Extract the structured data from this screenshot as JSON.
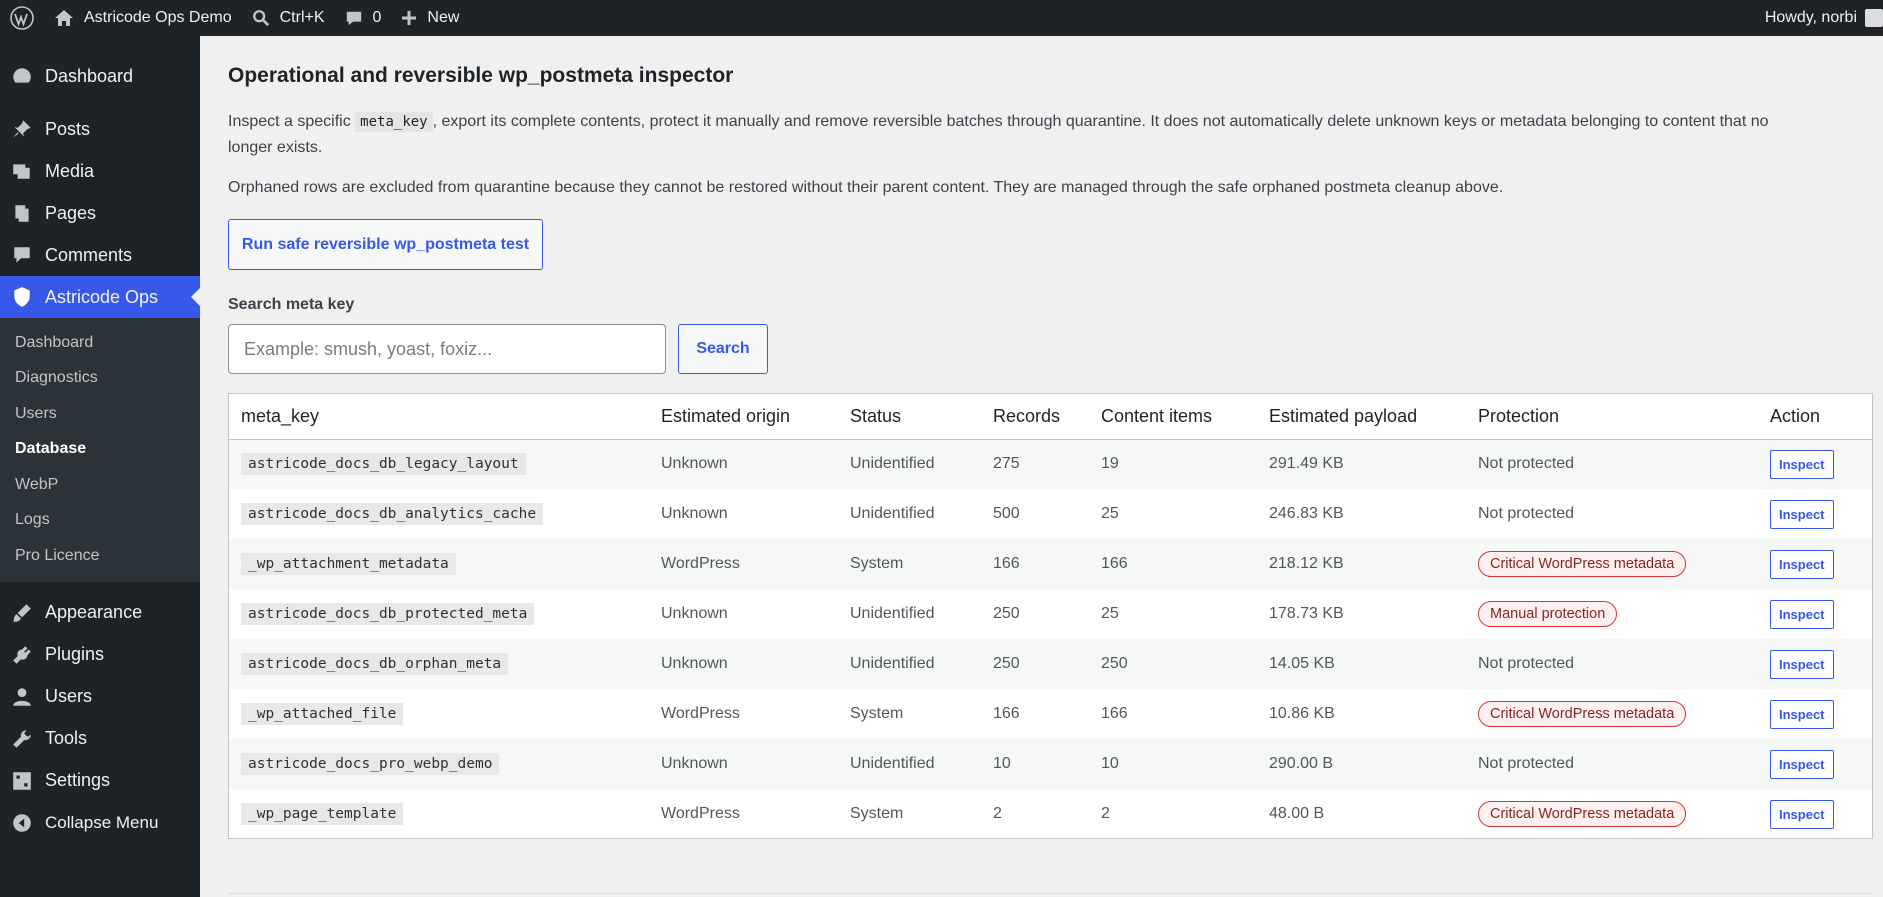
{
  "adminbar": {
    "site_name": "Astricode Ops Demo",
    "search_shortcut": "Ctrl+K",
    "comments_count": "0",
    "new_label": "New",
    "howdy": "Howdy, norbi"
  },
  "sidebar": {
    "items_top": [
      {
        "label": "Dashboard",
        "icon": "dashboard-icon"
      },
      {
        "label": "Posts",
        "icon": "pushpin-icon"
      },
      {
        "label": "Media",
        "icon": "media-icon"
      },
      {
        "label": "Pages",
        "icon": "pages-icon"
      },
      {
        "label": "Comments",
        "icon": "comment-icon"
      },
      {
        "label": "Astricode Ops",
        "icon": "shield-icon"
      }
    ],
    "submenu": [
      "Dashboard",
      "Diagnostics",
      "Users",
      "Database",
      "WebP",
      "Logs",
      "Pro Licence"
    ],
    "items_bottom": [
      {
        "label": "Appearance",
        "icon": "brush-icon"
      },
      {
        "label": "Plugins",
        "icon": "plug-icon"
      },
      {
        "label": "Users",
        "icon": "user-icon"
      },
      {
        "label": "Tools",
        "icon": "wrench-icon"
      },
      {
        "label": "Settings",
        "icon": "settings-icon"
      },
      {
        "label": "Collapse Menu",
        "icon": "collapse-icon"
      }
    ]
  },
  "main": {
    "title": "Operational and reversible wp_postmeta inspector",
    "desc1_before": "Inspect a specific ",
    "desc1_code": "meta_key",
    "desc1_after": ", export its complete contents, protect it manually and remove reversible batches through quarantine. It does not automatically delete unknown keys or metadata belonging to content that no longer exists.",
    "desc2": "Orphaned rows are excluded from quarantine because they cannot be restored without their parent content. They are managed through the safe orphaned postmeta cleanup above.",
    "run_button": "Run safe reversible wp_postmeta test",
    "search_label": "Search meta key",
    "search_placeholder": "Example: smush, yoast, foxiz...",
    "search_button": "Search"
  },
  "table": {
    "headers": [
      "meta_key",
      "Estimated origin",
      "Status",
      "Records",
      "Content items",
      "Estimated payload",
      "Protection",
      "Action"
    ],
    "rows": [
      {
        "key": "astricode_docs_db_legacy_layout",
        "origin": "Unknown",
        "status": "Unidentified",
        "records": "275",
        "items": "19",
        "payload": "291.49 KB",
        "protection": "Not protected",
        "badge": false,
        "action": "Inspect"
      },
      {
        "key": "astricode_docs_db_analytics_cache",
        "origin": "Unknown",
        "status": "Unidentified",
        "records": "500",
        "items": "25",
        "payload": "246.83 KB",
        "protection": "Not protected",
        "badge": false,
        "action": "Inspect"
      },
      {
        "key": "_wp_attachment_metadata",
        "origin": "WordPress",
        "status": "System",
        "records": "166",
        "items": "166",
        "payload": "218.12 KB",
        "protection": "Critical WordPress metadata",
        "badge": true,
        "action": "Inspect"
      },
      {
        "key": "astricode_docs_db_protected_meta",
        "origin": "Unknown",
        "status": "Unidentified",
        "records": "250",
        "items": "25",
        "payload": "178.73 KB",
        "protection": "Manual protection",
        "badge": true,
        "action": "Inspect"
      },
      {
        "key": "astricode_docs_db_orphan_meta",
        "origin": "Unknown",
        "status": "Unidentified",
        "records": "250",
        "items": "250",
        "payload": "14.05 KB",
        "protection": "Not protected",
        "badge": false,
        "action": "Inspect"
      },
      {
        "key": "_wp_attached_file",
        "origin": "WordPress",
        "status": "System",
        "records": "166",
        "items": "166",
        "payload": "10.86 KB",
        "protection": "Critical WordPress metadata",
        "badge": true,
        "action": "Inspect"
      },
      {
        "key": "astricode_docs_pro_webp_demo",
        "origin": "Unknown",
        "status": "Unidentified",
        "records": "10",
        "items": "10",
        "payload": "290.00 B",
        "protection": "Not protected",
        "badge": false,
        "action": "Inspect"
      },
      {
        "key": "_wp_page_template",
        "origin": "WordPress",
        "status": "System",
        "records": "2",
        "items": "2",
        "payload": "48.00 B",
        "protection": "Critical WordPress metadata",
        "badge": true,
        "action": "Inspect"
      }
    ]
  },
  "colors": {
    "accent": "#3858e9",
    "sidebar": "#1d2327",
    "badge_border": "#d63638"
  }
}
